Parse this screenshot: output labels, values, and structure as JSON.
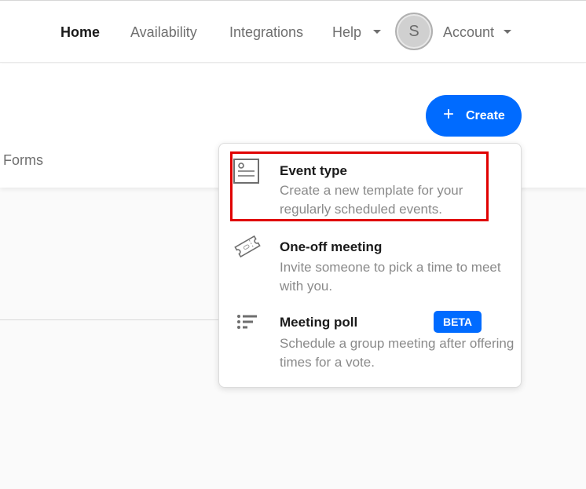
{
  "nav": {
    "items": [
      {
        "label": "Home",
        "active": true
      },
      {
        "label": "Availability",
        "active": false
      },
      {
        "label": "Integrations",
        "active": false
      },
      {
        "label": "Help",
        "active": false,
        "has_dropdown": true
      }
    ],
    "avatar_initial": "S",
    "account_label": "Account"
  },
  "header": {
    "tab_partial_label": "Forms",
    "create_button": {
      "icon": "plus-icon",
      "label": "Create"
    }
  },
  "create_menu": {
    "items": [
      {
        "icon": "event-type-card-icon",
        "title": "Event type",
        "description": "Create a new template for your regularly scheduled events.",
        "highlighted": true
      },
      {
        "icon": "ticket-icon",
        "title": "One-off meeting",
        "description": "Invite someone to pick a time to meet with you."
      },
      {
        "icon": "poll-list-icon",
        "title": "Meeting poll",
        "badge": "BETA",
        "description": "Schedule a group meeting after offering times for a vote."
      }
    ]
  },
  "colors": {
    "accent": "#006bff",
    "highlight_border": "#e00000",
    "text_primary": "#1a1a1a",
    "text_secondary": "#8a8a8a"
  }
}
